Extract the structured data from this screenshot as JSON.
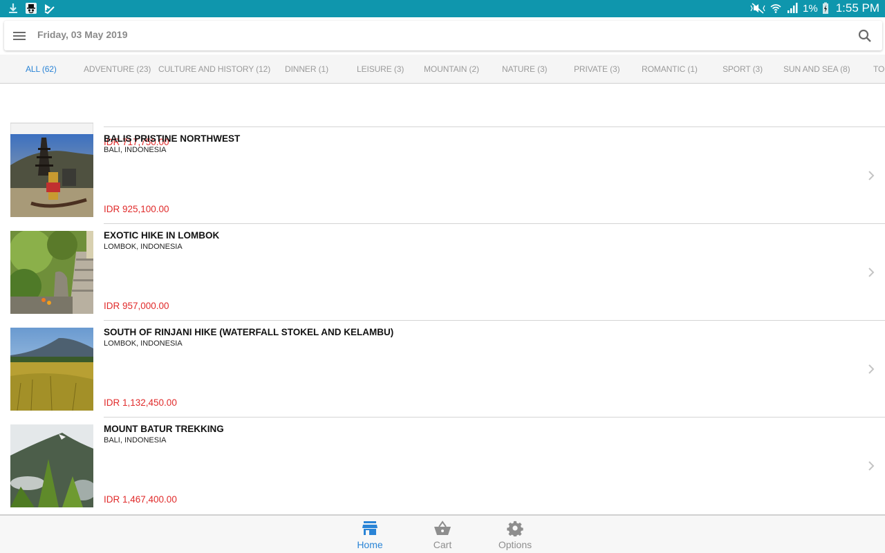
{
  "status_bar": {
    "left_icons": [
      "download-icon",
      "incognito-icon",
      "task-check-icon"
    ],
    "right_icons": [
      "mute-icon",
      "wifi-icon",
      "signal-icon"
    ],
    "battery_percent": "1%",
    "time": "1:55 PM"
  },
  "appbar": {
    "title": "Friday, 03 May 2019",
    "menu_icon": "hamburger-menu-icon",
    "search_icon": "search-icon"
  },
  "tabs": [
    {
      "label": "ALL (62)",
      "active": true
    },
    {
      "label": "ADVENTURE (23)",
      "active": false
    },
    {
      "label": "CULTURE AND HISTORY (12)",
      "active": false
    },
    {
      "label": "DINNER (1)",
      "active": false
    },
    {
      "label": "LEISURE (3)",
      "active": false
    },
    {
      "label": "MOUNTAIN (2)",
      "active": false
    },
    {
      "label": "NATURE (3)",
      "active": false
    },
    {
      "label": "PRIVATE (3)",
      "active": false
    },
    {
      "label": "ROMANTIC (1)",
      "active": false
    },
    {
      "label": "SPORT (3)",
      "active": false
    },
    {
      "label": "SUN AND SEA (8)",
      "active": false
    },
    {
      "label": "TOU",
      "active": false
    }
  ],
  "products": [
    {
      "title": "",
      "location": "",
      "price": "IDR 717,750.00",
      "image": "white-car"
    },
    {
      "title": "BALIS PRISTINE NORTHWEST",
      "location": "BALI, INDONESIA",
      "price": "IDR 925,100.00",
      "image": "bali-temple"
    },
    {
      "title": "EXOTIC HIKE IN LOMBOK",
      "location": "LOMBOK, INDONESIA",
      "price": "IDR 957,000.00",
      "image": "jungle-stairs"
    },
    {
      "title": "SOUTH OF RINJANI HIKE (WATERFALL STOKEL AND KELAMBU)",
      "location": "LOMBOK, INDONESIA",
      "price": "IDR 1,132,450.00",
      "image": "rice-field-volcano"
    },
    {
      "title": "MOUNT BATUR TREKKING",
      "location": "BALI, INDONESIA",
      "price": "IDR 1,467,400.00",
      "image": "mountain-forest"
    }
  ],
  "bottom_nav": [
    {
      "label": "Home",
      "icon": "store-icon",
      "active": true
    },
    {
      "label": "Cart",
      "icon": "basket-icon",
      "active": false
    },
    {
      "label": "Options",
      "icon": "gear-icon",
      "active": false
    }
  ],
  "colors": {
    "status_bar": "#0f96ad",
    "accent": "#2a84d6",
    "price": "#e02a2a"
  }
}
